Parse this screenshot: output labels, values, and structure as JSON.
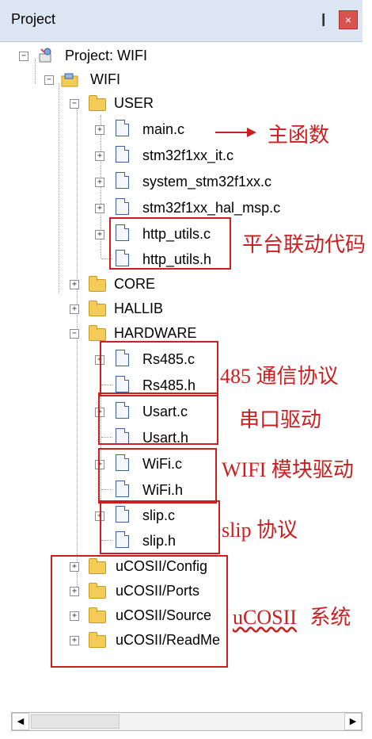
{
  "panel": {
    "title": "Project",
    "pin_glyph": "❙",
    "close_glyph": "×"
  },
  "tree": {
    "project": "Project: WIFI",
    "target": "WIFI",
    "groups": {
      "user": "USER",
      "core": "CORE",
      "hallib": "HALLIB",
      "hardware": "HARDWARE",
      "config": "uCOSII/Config",
      "ports": "uCOSII/Ports",
      "source": "uCOSII/Source",
      "readme": "uCOSII/ReadMe"
    },
    "files": {
      "main_c": "main.c",
      "it_c": "stm32f1xx_it.c",
      "system_c": "system_stm32f1xx.c",
      "msp_c": "stm32f1xx_hal_msp.c",
      "http_c": "http_utils.c",
      "http_h": "http_utils.h",
      "rs485_c": "Rs485.c",
      "rs485_h": "Rs485.h",
      "usart_c": "Usart.c",
      "usart_h": "Usart.h",
      "wifi_c": "WiFi.c",
      "wifi_h": "WiFi.h",
      "slip_c": "slip.c",
      "slip_h": "slip.h"
    }
  },
  "annotations": {
    "main_function": "主函数",
    "platform_link": "平台联动代码",
    "rs485_protocol": "485 通信协议",
    "serial_driver": "串口驱动",
    "wifi_driver": "WIFI 模块驱动",
    "slip_protocol": "slip 协议",
    "ucosii_word": "uCOSII",
    "ucosii_suffix": "系统"
  },
  "colors": {
    "annotation": "#cc1f1f",
    "titlebar": "#dce6f3"
  },
  "scrollbar": {
    "left_glyph": "◀",
    "right_glyph": "▶"
  }
}
